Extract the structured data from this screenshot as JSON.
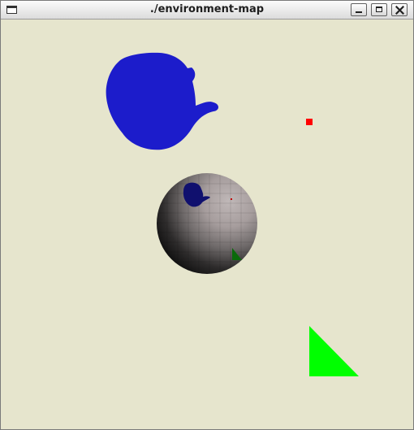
{
  "window": {
    "title": "./environment-map",
    "menu_icon": "window-menu-icon",
    "controls": [
      "minimize-icon",
      "maximize-icon",
      "close-icon"
    ]
  },
  "scene": {
    "background_color": "#e6e5cd",
    "objects": [
      {
        "name": "teapot",
        "color": "#1c1ccb"
      },
      {
        "name": "cube",
        "color": "#ff0000"
      },
      {
        "name": "sphere",
        "color": "#b0a8a8"
      },
      {
        "name": "cone",
        "color": "#00ff00"
      }
    ]
  }
}
